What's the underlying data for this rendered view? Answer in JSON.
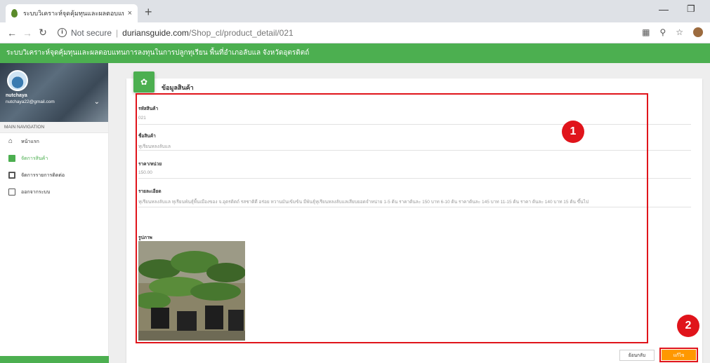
{
  "browser": {
    "tab_title": "ระบบวิเคราะห์จุดคุ้มทุนและผลตอบแทน",
    "tab_close": "×",
    "new_tab": "+",
    "url_not_secure": "Not secure",
    "url_domain": "duriansguide.com",
    "url_path": "/Shop_cl/product_detail/021"
  },
  "app": {
    "header_title": "ระบบวิเคราะห์จุดคุ้มทุนและผลตอบแทนการลงทุนในการปลูกทุเรียน พื้นที่อำเภอลับแล จังหวัดอุตรดิตถ์"
  },
  "user": {
    "name": "nutchaya",
    "email": "nutchaya22@gmail.com"
  },
  "sidebar": {
    "nav_heading": "MAIN NAVIGATION",
    "items": [
      {
        "label": "หน้าแรก",
        "icon": "home-icon"
      },
      {
        "label": "จัดการสินค้า",
        "icon": "document-icon"
      },
      {
        "label": "จัดการรายการติดต่อ",
        "icon": "contact-list-icon"
      },
      {
        "label": "ออกจากระบบ",
        "icon": "logout-icon"
      }
    ],
    "active_index": 1
  },
  "page": {
    "title": "ข้อมูลสินค้า",
    "fields": {
      "code_label": "รหัสสินค้า",
      "code_value": "021",
      "name_label": "ชื่อสินค้า",
      "name_value": "ทุเรียนหลงลับแล",
      "price_label": "ราคา/หน่วย",
      "price_value": "150.00",
      "detail_label": "รายละเอียด",
      "detail_value": "ทุเรียนหลงลับแล ทุเรียนพันธุ์พื้นเมืองของ จ.อุตรดิตถ์ รสชาติดี อร่อย หวานมันเข้มข้น มีพันธุ์ทุเรียนหลงลับแลเสียบยอดจำหน่าย 1-5 ต้น ราคาต้นละ 150 บาท 6-10 ต้น ราคาต้นละ 145 บาท 11-15 ต้น ราคา ต้นละ 140 บาท 15 ต้น ขึ้นไป",
      "image_label": "รูปภาพ"
    },
    "back_button": "ย้อนกลับ",
    "edit_button": "แก้ไข"
  },
  "annotations": {
    "badge1": "1",
    "badge2": "2"
  },
  "colors": {
    "brand_green": "#4caf50",
    "annotation_red": "#e0141b",
    "edit_orange": "#ff9800"
  }
}
